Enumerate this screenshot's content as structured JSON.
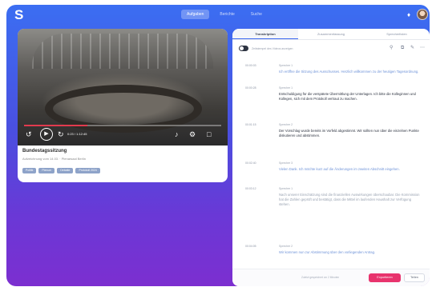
{
  "app": {
    "logo_text": "S",
    "nav_tabs": [
      "Aufgaben",
      "Berichte",
      "Suche"
    ],
    "accent": "#3a67f0"
  },
  "player": {
    "progress": 0.32,
    "time": "0:23 / 1:12:45",
    "title": "Bundestagssitzung",
    "subtitle": "Aufzeichnung vom 14.03. · Plenarsaal Berlin",
    "chips": [
      "Politik",
      "Plenum",
      "Debatte",
      "Protokoll 2024"
    ]
  },
  "panel": {
    "tabs": [
      "Transkription",
      "Zusammenfassung",
      "Sprecherlisten"
    ],
    "toggle_label": "Zeitstempel des Videos anzeigen",
    "entries": [
      {
        "time": "00:00:03",
        "speaker": "Sprecher 1",
        "text": "Ich eröffne die Sitzung des Ausschusses. Herzlich willkommen zu der heutigen Tagesordnung.",
        "style": "blue"
      },
      {
        "time": "00:00:28",
        "speaker": "Sprecher 1",
        "text": "Entschuldigung für die verspätete Übermittlung der Unterlagen. Ich bitte die Kolleginnen und Kollegen, sich mit dem Protokoll vertraut zu machen.",
        "style": "dark"
      },
      {
        "time": "00:01:15",
        "speaker": "Sprecher 2",
        "text": "Der Vorschlag wurde bereits im Vorfeld abgestimmt. Wir sollten nun über die einzelnen Punkte diskutieren und abstimmen.",
        "style": "dark"
      },
      {
        "time": "00:02:40",
        "speaker": "Sprecher 3",
        "text": "Vielen Dank. Ich möchte kurz auf die Änderungen im zweiten Abschnitt eingehen.",
        "style": "blue"
      },
      {
        "time": "00:03:12",
        "speaker": "Sprecher 1",
        "text": "Nach unserer Einschätzung sind die finanziellen Auswirkungen überschaubar. Die Kommission hat die Zahlen geprüft und bestätigt, dass die Mittel im laufenden Haushalt zur Verfügung stehen.",
        "style": "grey"
      },
      {
        "time": "00:04:05",
        "speaker": "Sprecher 2",
        "text": "Wir kommen nun zur Abstimmung über den vorliegenden Antrag.",
        "style": "blue"
      }
    ],
    "footer_note": "Zuletzt gespeichert vor 2 Minuten",
    "primary_button": "Exportieren",
    "secondary_button": "Teilen"
  }
}
